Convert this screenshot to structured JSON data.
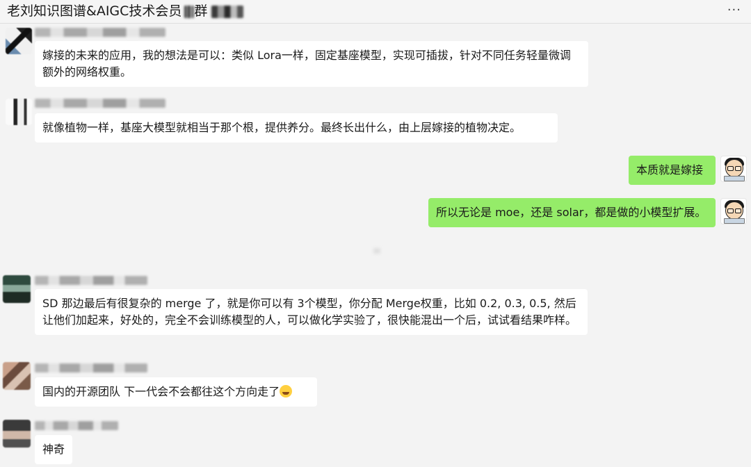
{
  "window": {
    "title": "老刘知识图谱&AIGC技术会员",
    "title_suffix": "群",
    "more_icon": "more-horizontal-icon",
    "more_glyph": "···"
  },
  "messages": [
    {
      "side": "left",
      "text": "嫁接的未来的应用，我的想法是可以：类似 Lora一样，固定基座模型，实现可插拔，针对不同任务轻量微调额外的网络权重。"
    },
    {
      "side": "left",
      "text": "就像植物一样，基座大模型就相当于那个根，提供养分。最终长出什么，由上层嫁接的植物决定。"
    },
    {
      "side": "right",
      "text": "本质就是嫁接"
    },
    {
      "side": "right",
      "text": "所以无论是 moe，还是 solar，都是做的小模型扩展。"
    },
    {
      "side": "left",
      "text": "SD 那边最后有很复杂的 merge 了，就是你可以有 3个模型，你分配 Merge权重，比如 0.2, 0.3, 0.5, 然后让他们加起来，好处的，完全不会训练模型的人，可以做化学实验了，很快能混出一个后，试试看结果咋样。"
    },
    {
      "side": "left",
      "text": "国内的开源团队 下一代会不会都往这个方向走了",
      "emoji": "laughing-tears-icon"
    },
    {
      "side": "left",
      "text": "神奇"
    }
  ]
}
